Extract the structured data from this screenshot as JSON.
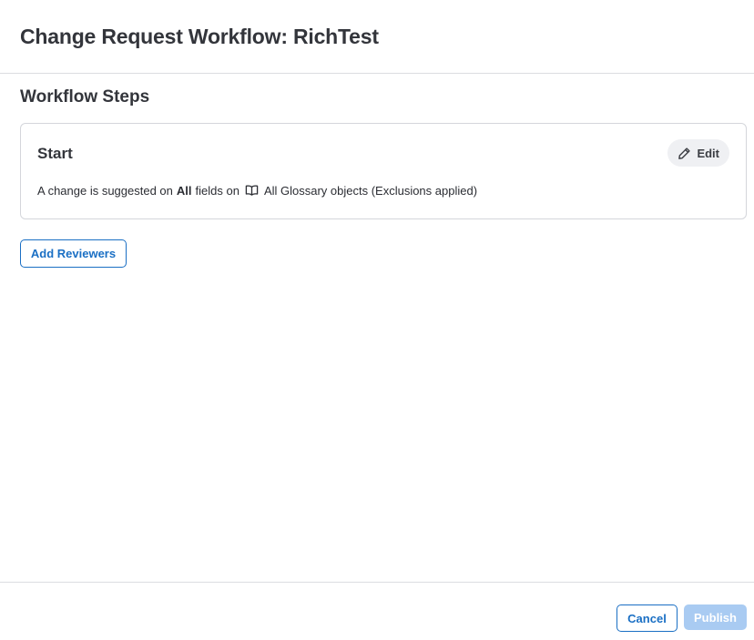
{
  "header": {
    "title": "Change Request Workflow: RichTest"
  },
  "workflow": {
    "section_title": "Workflow Steps",
    "step": {
      "title": "Start",
      "edit_label": "Edit",
      "desc_prefix": "A change is suggested on",
      "desc_bold": "All",
      "desc_mid": "fields on",
      "desc_suffix": "All Glossary objects (Exclusions applied)",
      "icon": "book-open-icon"
    },
    "add_reviewers_label": "Add Reviewers"
  },
  "footer": {
    "cancel_label": "Cancel",
    "publish_label": "Publish",
    "publish_disabled": true
  },
  "colors": {
    "accent": "#1a6fc4",
    "accent_disabled": "#a9cbf2",
    "border": "#d4d6db",
    "text": "#2b2d33"
  }
}
